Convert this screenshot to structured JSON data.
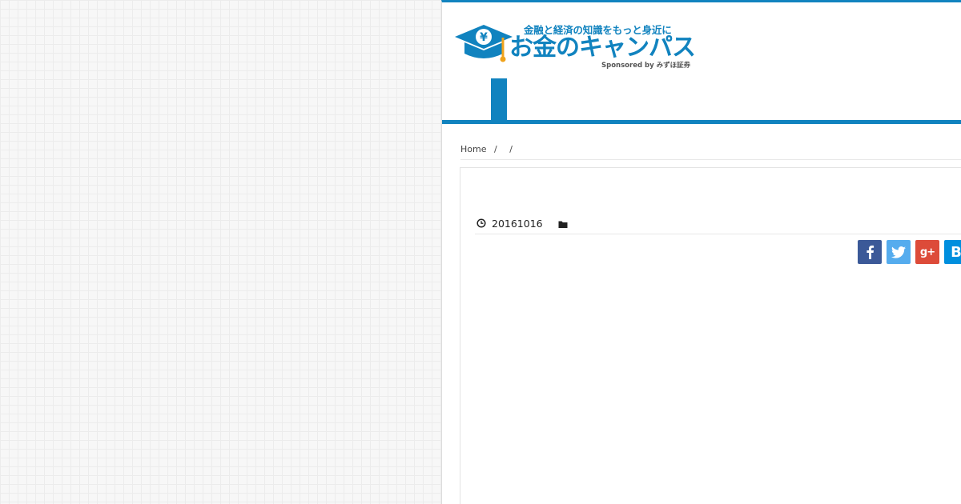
{
  "header": {
    "tagline": "金融と経済の知識をもっと身近に",
    "site_title": "お金のキャンパス",
    "sponsor": "Sponsored by みずほ証券",
    "logo_symbol": "¥"
  },
  "breadcrumb": {
    "home": "Home",
    "separator": "/"
  },
  "article": {
    "date": "20161016",
    "date_icon": "clock-icon",
    "category_icon": "folder-icon"
  },
  "share": {
    "facebook_icon": "facebook-icon",
    "twitter_icon": "twitter-icon",
    "googleplus_label": "g+",
    "hatena_label": "B"
  },
  "colors": {
    "brand": "#1183bf",
    "facebook": "#3b5998",
    "twitter": "#55acee",
    "googleplus": "#dd4b39",
    "hatena": "#008fde"
  }
}
